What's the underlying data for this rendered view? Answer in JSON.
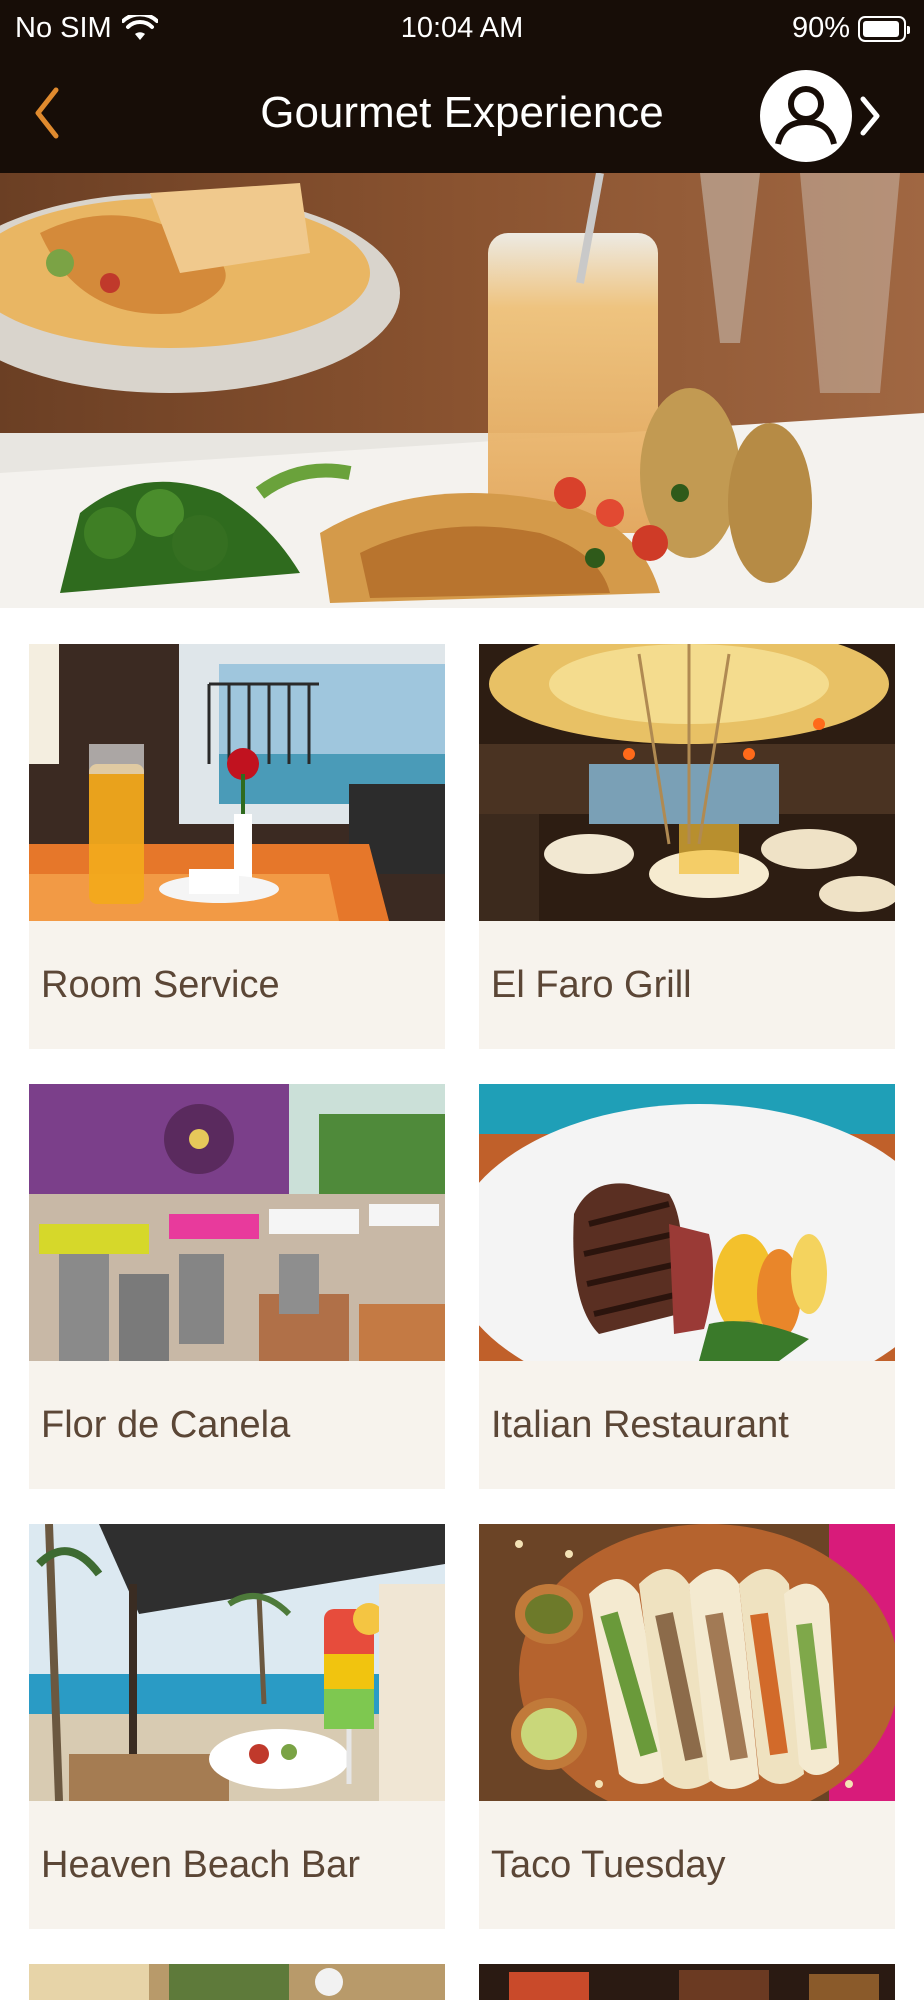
{
  "status_bar": {
    "carrier": "No SIM",
    "time": "10:04 AM",
    "battery": "90%"
  },
  "header": {
    "title": "Gourmet Experience"
  },
  "venues": [
    {
      "name": "Room Service"
    },
    {
      "name": "El Faro Grill"
    },
    {
      "name": "Flor de Canela"
    },
    {
      "name": "Italian Restaurant"
    },
    {
      "name": "Heaven Beach Bar"
    },
    {
      "name": "Taco Tuesday"
    }
  ],
  "colors": {
    "header_bg": "#170d07",
    "accent": "#e08a2e",
    "card_bg": "#f7f3ed",
    "card_text": "#5b4636"
  }
}
